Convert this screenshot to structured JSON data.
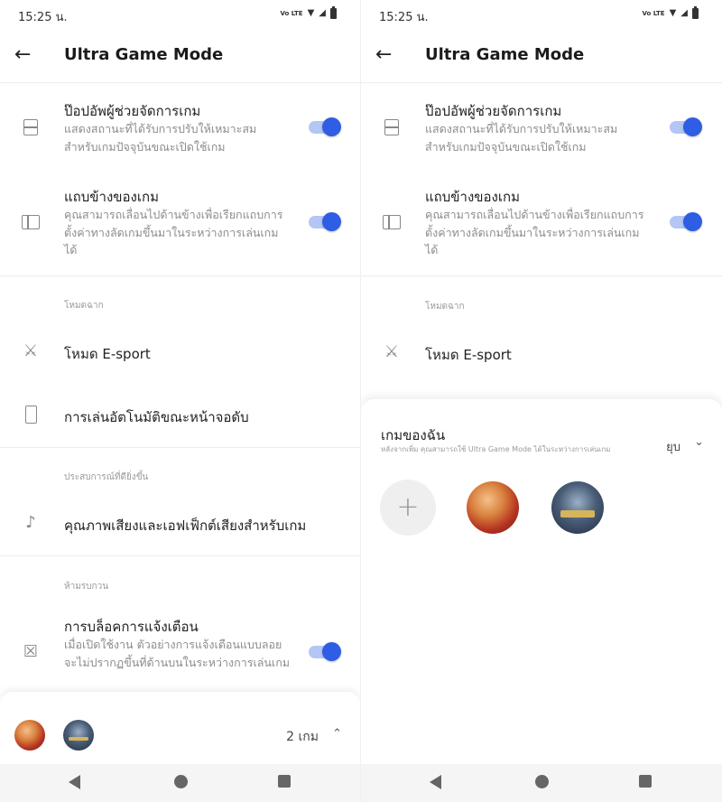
{
  "status_bar": {
    "time": "15:25 น.",
    "volte": "Vo LTE"
  },
  "header": {
    "title": "Ultra Game Mode"
  },
  "settings": {
    "popup_title": "ป๊อปอัพผู้ช่วยจัดการเกม",
    "popup_sub": "แสดงสถานะที่ได้รับการปรับให้เหมาะสมสำหรับเกมปัจจุบันขณะเปิดใช้เกม",
    "popup_enabled": true,
    "sidebar_title": "แถบข้างของเกม",
    "sidebar_sub": "คุณสามารถเลื่อนไปด้านข้างเพื่อเรียกแถบการตั้งค่าทางลัดเกมขึ้นมาในระหว่างการเล่นเกมได้",
    "sidebar_enabled": true,
    "scene_mode_label": "โหมดฉาก",
    "esport_label": "โหมด E-sport",
    "autoplay_label": "การเล่นอัตโนมัติขณะหน้าจอดับ",
    "experience_label": "ประสบการณ์ที่ดียิ่งขึ้น",
    "sound_label": "คุณภาพเสียงและเอฟเฟ็กต์เสียงสำหรับเกม",
    "dnd_label": "ห้ามรบกวน",
    "block_title": "การบล็อคการแจ้งเตือน",
    "block_sub": "เมื่อเปิดใช้งาน ตัวอย่างการแจ้งเตือนแบบลอยจะไม่ปรากฏขึ้นที่ด้านบนในระหว่างการเล่นเกม",
    "block_enabled": true
  },
  "bottom_bar": {
    "count": "2 เกม"
  },
  "sheet": {
    "title": "เกมของฉัน",
    "subtitle": "หลังจากเพิ่ม คุณสามารถใช้ Ultra Game Mode ได้ในระหว่างการเล่นเกม",
    "collapse_label": "ยุบ"
  },
  "icons": {
    "back": "back-arrow-icon",
    "popup": "popup-window-icon",
    "sidebar": "sidebar-icon",
    "esport": "crossed-swords-icon",
    "autoplay": "phone-icon",
    "sound": "ear-icon",
    "block": "notification-off-icon",
    "add": "plus-icon"
  },
  "colors": {
    "accent": "#2f5de4",
    "toggle_track": "#b3c6f5"
  }
}
